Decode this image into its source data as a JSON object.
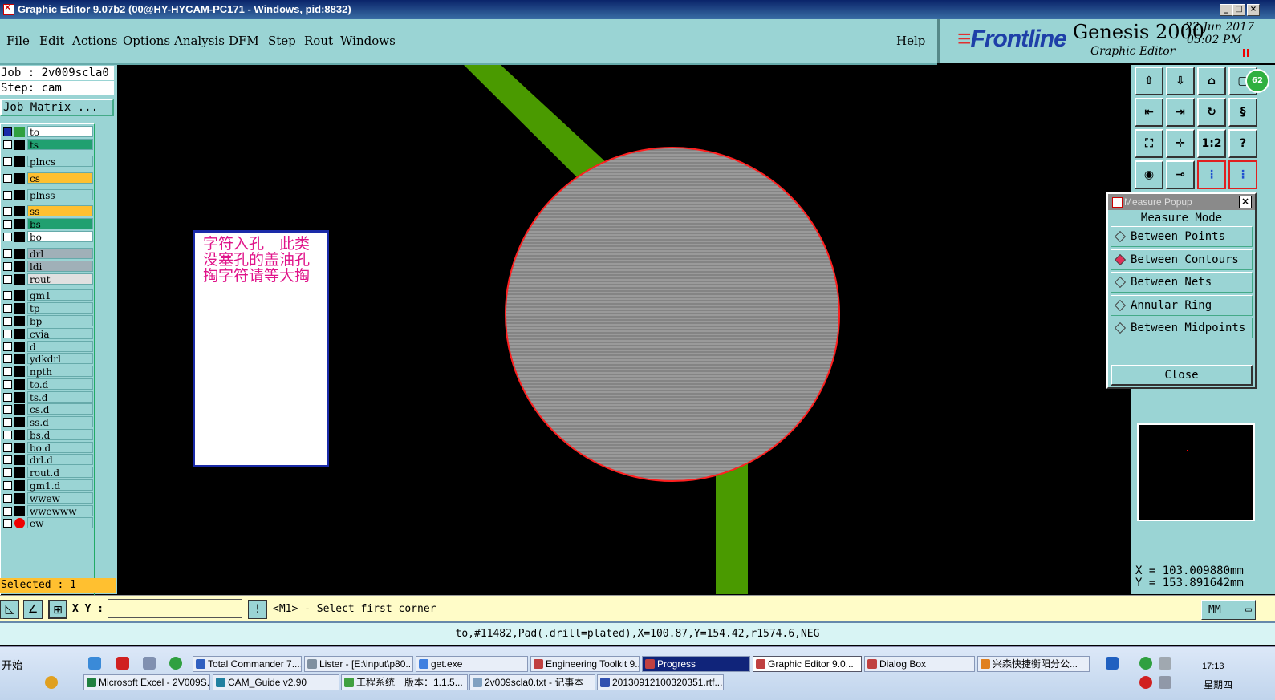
{
  "window": {
    "title": "Graphic Editor 9.07b2 (00@HY-HYCAM-PC171 - Windows, pid:8832)"
  },
  "menu": [
    "File",
    "Edit",
    "Actions",
    "Options",
    "Analysis",
    "DFM",
    "Step",
    "Rout",
    "Windows"
  ],
  "help_label": "Help",
  "branding": {
    "logo": "Frontline",
    "product": "Genesis 2000",
    "subtitle": "Graphic Editor",
    "date": "22 Jun 2017",
    "time": "05:02 PM"
  },
  "job": {
    "job_line": "Job : 2v009scla0",
    "step_line": "Step: cam",
    "matrix_label": "Job Matrix ..."
  },
  "layers": [
    {
      "name": "to",
      "color": "#ffffff",
      "marker": "cursor",
      "checked": true
    },
    {
      "name": "ts",
      "color": "#20a070",
      "marker": ""
    },
    {
      "name": "plncs",
      "color": "#9ad4d4",
      "marker": ""
    },
    {
      "name": "cs",
      "color": "#ffc030",
      "marker": ""
    },
    {
      "name": "plnss",
      "color": "#9ad4d4",
      "marker": ""
    },
    {
      "name": "ss",
      "color": "#ffc030",
      "marker": ""
    },
    {
      "name": "bs",
      "color": "#20a070",
      "marker": ""
    },
    {
      "name": "bo",
      "color": "#ffffff",
      "marker": ""
    },
    {
      "name": "drl",
      "color": "#a0b0b8",
      "marker": ""
    },
    {
      "name": "ldi",
      "color": "#a0b0b8",
      "marker": ""
    },
    {
      "name": "rout",
      "color": "#e0e0e0",
      "marker": ""
    },
    {
      "name": "gm1",
      "color": "#9ad4d4",
      "marker": ""
    },
    {
      "name": "tp",
      "color": "#9ad4d4",
      "marker": ""
    },
    {
      "name": "bp",
      "color": "#9ad4d4",
      "marker": ""
    },
    {
      "name": "cvia",
      "color": "#9ad4d4",
      "marker": ""
    },
    {
      "name": "d",
      "color": "#9ad4d4",
      "marker": ""
    },
    {
      "name": "ydkdrl",
      "color": "#9ad4d4",
      "marker": ""
    },
    {
      "name": "npth",
      "color": "#9ad4d4",
      "marker": ""
    },
    {
      "name": "to.d",
      "color": "#9ad4d4",
      "marker": ""
    },
    {
      "name": "ts.d",
      "color": "#9ad4d4",
      "marker": ""
    },
    {
      "name": "cs.d",
      "color": "#9ad4d4",
      "marker": ""
    },
    {
      "name": "ss.d",
      "color": "#9ad4d4",
      "marker": ""
    },
    {
      "name": "bs.d",
      "color": "#9ad4d4",
      "marker": ""
    },
    {
      "name": "bo.d",
      "color": "#9ad4d4",
      "marker": ""
    },
    {
      "name": "drl.d",
      "color": "#9ad4d4",
      "marker": ""
    },
    {
      "name": "rout.d",
      "color": "#9ad4d4",
      "marker": ""
    },
    {
      "name": "gm1.d",
      "color": "#9ad4d4",
      "marker": ""
    },
    {
      "name": "wwew",
      "color": "#9ad4d4",
      "marker": ""
    },
    {
      "name": "wwewww",
      "color": "#9ad4d4",
      "marker": ""
    },
    {
      "name": "ew",
      "color": "#9ad4d4",
      "marker": "red-dot"
    }
  ],
  "selected": "Selected : 1",
  "note": "字符入孔　此类没塞孔的盖油孔掏字符请等大掏",
  "toolbar_icons": [
    "layer-up-icon",
    "layer-down-icon",
    "home-icon",
    "window-icon",
    "pan-left-icon",
    "pan-right-icon",
    "redraw-icon",
    "zoom-step-icon",
    "fit-icon",
    "zoom-center-icon",
    "ratio-icon",
    "help-icon",
    "eye-icon",
    "probe-icon",
    "net-icon",
    "net2-icon"
  ],
  "toolbar_labels": {
    "ratio": "1:2",
    "help": "?"
  },
  "badge": "62",
  "measure": {
    "title": "Measure Popup",
    "mode_label": "Measure Mode",
    "options": [
      {
        "label": "Between Points",
        "selected": false
      },
      {
        "label": "Between Contours",
        "selected": true
      },
      {
        "label": "Between Nets",
        "selected": false
      },
      {
        "label": "Annular Ring",
        "selected": false
      },
      {
        "label": "Between Midpoints",
        "selected": false
      }
    ],
    "close_label": "Close"
  },
  "coords": {
    "x": "X = 103.009880mm",
    "y": "Y = 153.891642mm"
  },
  "command": {
    "xy_label": "X Y :",
    "xy_value": "",
    "prompt": "<M1> - Select first corner",
    "unit": "MM"
  },
  "info": "to,#11482,Pad(.drill=plated),X=100.87,Y=154.42,r1574.6,NEG",
  "taskbar": {
    "start": "开始",
    "row1": [
      {
        "label": "Total Commander 7....",
        "color": "#3060c0"
      },
      {
        "label": "Lister - [E:\\input\\p80...",
        "color": "#8090a0"
      },
      {
        "label": "get.exe",
        "color": "#4080e0"
      },
      {
        "label": "Engineering Toolkit 9...",
        "color": "#c04040"
      },
      {
        "label": "Progress",
        "color": "#c04040",
        "state": "progress"
      },
      {
        "label": "Graphic Editor 9.0...",
        "color": "#c04040",
        "state": "active"
      },
      {
        "label": "Dialog Box",
        "color": "#c04040"
      },
      {
        "label": "兴森快捷衡阳分公...",
        "color": "#e08020"
      }
    ],
    "row2": [
      {
        "label": "Microsoft Excel - 2V009S...",
        "color": "#208040"
      },
      {
        "label": "CAM_Guide v2.90",
        "color": "#2080a0"
      },
      {
        "label": "工程系统　版本：1.1.5...",
        "color": "#40a040"
      },
      {
        "label": "2v009scla0.txt - 记事本",
        "color": "#80a0c0"
      },
      {
        "label": "20130912100320351.rtf...",
        "color": "#3050b0"
      }
    ],
    "clock": "17:13",
    "weekday": "星期四"
  }
}
